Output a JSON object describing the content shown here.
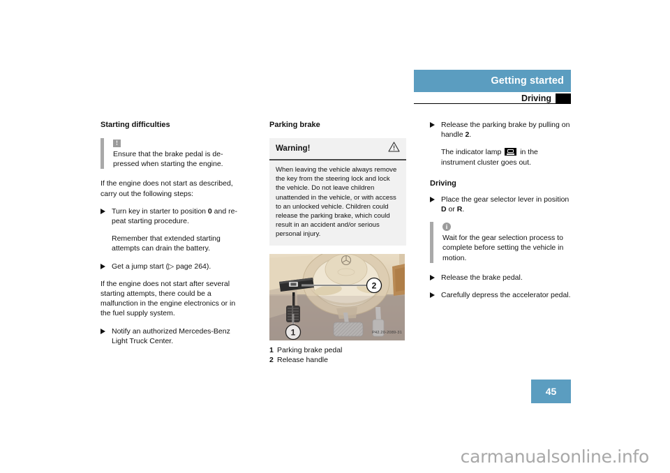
{
  "header": {
    "band_title": "Getting started",
    "sub_title": "Driving"
  },
  "page_number": "45",
  "watermark": "carmanualsonline.info",
  "column_left": {
    "heading": "Starting difficulties",
    "note": {
      "icon": "exclamation-icon",
      "text": "Ensure that the brake pedal is de-pressed when starting the engine."
    },
    "para_1": "If the engine does not start as described, carry out the following steps:",
    "bullet_1_pre": "Turn key in starter to position ",
    "bullet_1_bold": "0",
    "bullet_1_post": " and re-peat starting procedure.",
    "bullet_1_cont": "Remember that extended starting attempts can drain the battery.",
    "bullet_2": "Get a jump start (▷ page 264).",
    "para_2": "If the engine does not start after several starting attempts, there could be a malfunction in the engine electronics or in the fuel supply system.",
    "bullet_3": "Notify an authorized Mercedes-Benz Light Truck Center."
  },
  "column_middle": {
    "heading": "Parking brake",
    "warning": {
      "title": "Warning!",
      "icon": "warning-triangle-icon",
      "body": "When leaving the vehicle always remove the key from the steering lock and lock the vehicle. Do not leave children unattended in the vehicle, or with access to an unlocked vehicle. Children could release the parking brake, which could result in an accident and/or serious personal injury."
    },
    "figure": {
      "alt": "vehicle-footwell-parking-brake-illustration",
      "photo_id": "P42.20-2089-31",
      "callouts": [
        {
          "num": "1",
          "label": "Parking brake pedal"
        },
        {
          "num": "2",
          "label": "Release handle"
        }
      ]
    }
  },
  "column_right": {
    "bullet_1_pre": "Release the parking brake by pulling on handle ",
    "bullet_1_bold": "2",
    "bullet_1_post": ".",
    "bullet_1_cont_pre": "The indicator lamp ",
    "bullet_1_cont_icon": "brake-indicator-lamp-icon",
    "bullet_1_cont_post": " in the instrument cluster goes out.",
    "heading": "Driving",
    "bullet_2_pre": "Place the gear selector lever in position ",
    "bullet_2_bold_1": "D",
    "bullet_2_mid": " or ",
    "bullet_2_bold_2": "R",
    "bullet_2_post": ".",
    "note": {
      "icon": "info-icon",
      "text": "Wait for the gear selection process to complete before setting the vehicle in motion."
    },
    "bullet_3": "Release the brake pedal.",
    "bullet_4": "Carefully depress the accelerator pedal."
  },
  "colors": {
    "accent_blue": "#5b9dc0",
    "note_bar_gray": "#a9a9a9",
    "warning_bg": "#f1f1f1"
  }
}
